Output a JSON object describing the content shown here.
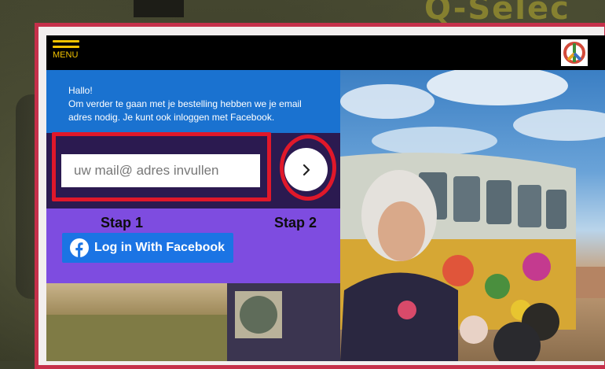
{
  "background": {
    "brand_text": "Q-Selec"
  },
  "header": {
    "menu_label": "MENU",
    "logo_icon": "peace-sign-icon"
  },
  "login": {
    "greeting": "Hallo!",
    "message": "Om verder te gaan met je bestelling hebben we je email adres nodig. Je kunt ook inloggen met Facebook.",
    "email_placeholder": "uw mail@ adres invullen",
    "next_icon": "chevron-right-icon",
    "step1_label": "Stap 1",
    "step2_label": "Stap 2",
    "facebook_label": "Log in With Facebook"
  },
  "colors": {
    "frame": "#c5304a",
    "blue_panel": "#1a72d0",
    "dark_panel": "#2b1a50",
    "purple_panel": "#7e4ce0",
    "highlight": "#e0182a",
    "facebook": "#1b74e4",
    "menu_accent": "#f2c200"
  }
}
